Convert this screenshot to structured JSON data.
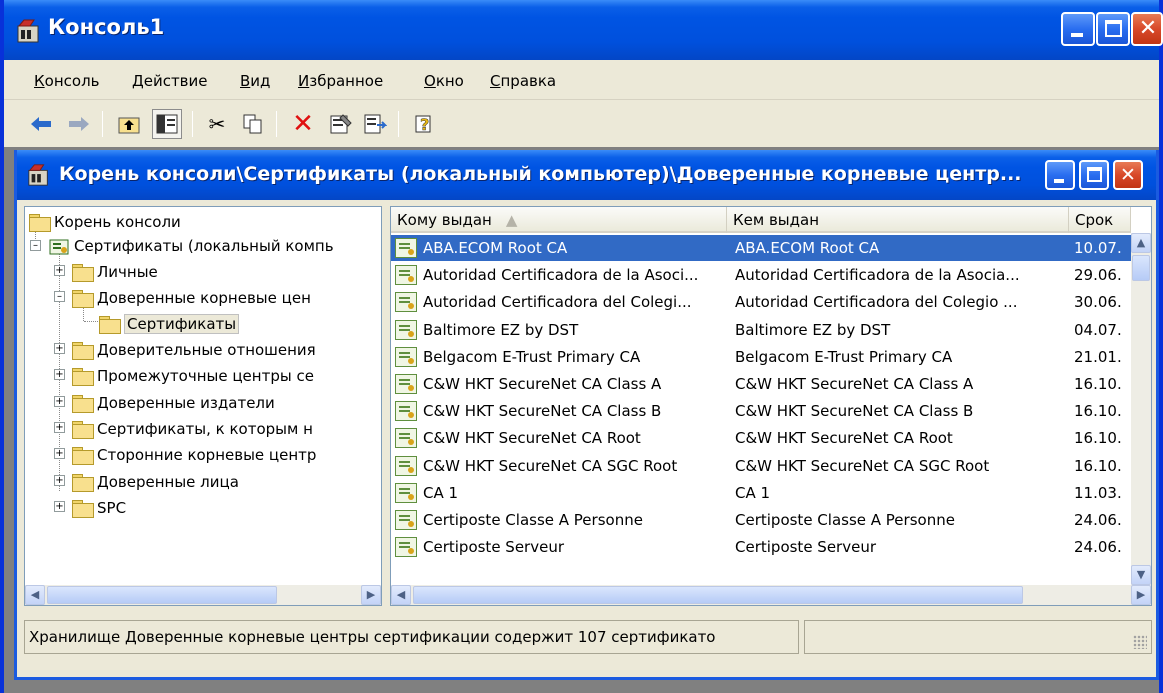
{
  "window": {
    "title": "Консоль1"
  },
  "menu": [
    {
      "label": "Консоль",
      "ul": "К",
      "rest": "онсоль"
    },
    {
      "label": "Действие",
      "ul": "Д",
      "rest": "ействие"
    },
    {
      "label": "Вид",
      "ul": "В",
      "rest": "ид"
    },
    {
      "label": "Избранное",
      "ul": "И",
      "rest": "збранное"
    },
    {
      "label": "Окно",
      "ul": "О",
      "rest": "кно"
    },
    {
      "label": "Справка",
      "ul": "С",
      "rest": "правка"
    }
  ],
  "toolbar_icons": [
    "back-arrow-icon",
    "forward-arrow-icon",
    "up-folder-icon",
    "show-hide-tree-icon",
    "cut-icon",
    "copy-icon",
    "delete-icon",
    "properties-icon",
    "export-list-icon",
    "help-icon"
  ],
  "inner": {
    "title": "Корень консоли\\Сертификаты (локальный компьютер)\\Доверенные корневые центр..."
  },
  "tree": {
    "root": "Корень консоли",
    "certs": "Сертификаты (локальный компь",
    "items": [
      "Личные",
      "Доверенные корневые цен",
      "Сертификаты",
      "Доверительные отношения",
      "Промежуточные центры се",
      "Доверенные издатели",
      "Сертификаты, к которым н",
      "Сторонние корневые центр",
      "Доверенные лица",
      "SPC"
    ]
  },
  "list": {
    "columns": [
      "Кому выдан",
      "Кем выдан",
      "Срок"
    ],
    "rows": [
      {
        "to": "ABA.ECOM Root CA",
        "by": "ABA.ECOM Root CA",
        "exp": "10.07."
      },
      {
        "to": "Autoridad Certificadora de la Asoci...",
        "by": "Autoridad Certificadora de la Asocia...",
        "exp": "29.06."
      },
      {
        "to": "Autoridad Certificadora del Colegi...",
        "by": "Autoridad Certificadora del Colegio ...",
        "exp": "30.06."
      },
      {
        "to": "Baltimore EZ by DST",
        "by": "Baltimore EZ by DST",
        "exp": "04.07."
      },
      {
        "to": "Belgacom E-Trust Primary CA",
        "by": "Belgacom E-Trust Primary CA",
        "exp": "21.01."
      },
      {
        "to": "C&W HKT SecureNet CA Class A",
        "by": "C&W HKT SecureNet CA Class A",
        "exp": "16.10."
      },
      {
        "to": "C&W HKT SecureNet CA Class B",
        "by": "C&W HKT SecureNet CA Class B",
        "exp": "16.10."
      },
      {
        "to": "C&W HKT SecureNet CA Root",
        "by": "C&W HKT SecureNet CA Root",
        "exp": "16.10."
      },
      {
        "to": "C&W HKT SecureNet CA SGC Root",
        "by": "C&W HKT SecureNet CA SGC Root",
        "exp": "16.10."
      },
      {
        "to": "CA 1",
        "by": "CA 1",
        "exp": "11.03."
      },
      {
        "to": "Certiposte Classe A Personne",
        "by": "Certiposte Classe A Personne",
        "exp": "24.06."
      },
      {
        "to": "Certiposte Serveur",
        "by": "Certiposte Serveur",
        "exp": "24.06."
      }
    ]
  },
  "status": {
    "text": "Хранилище Доверенные корневые центры сертификации содержит 107 сертификато"
  },
  "colors": {
    "titlebar": "#0054e3",
    "selection": "#316ac5",
    "chrome": "#ece9d8"
  }
}
